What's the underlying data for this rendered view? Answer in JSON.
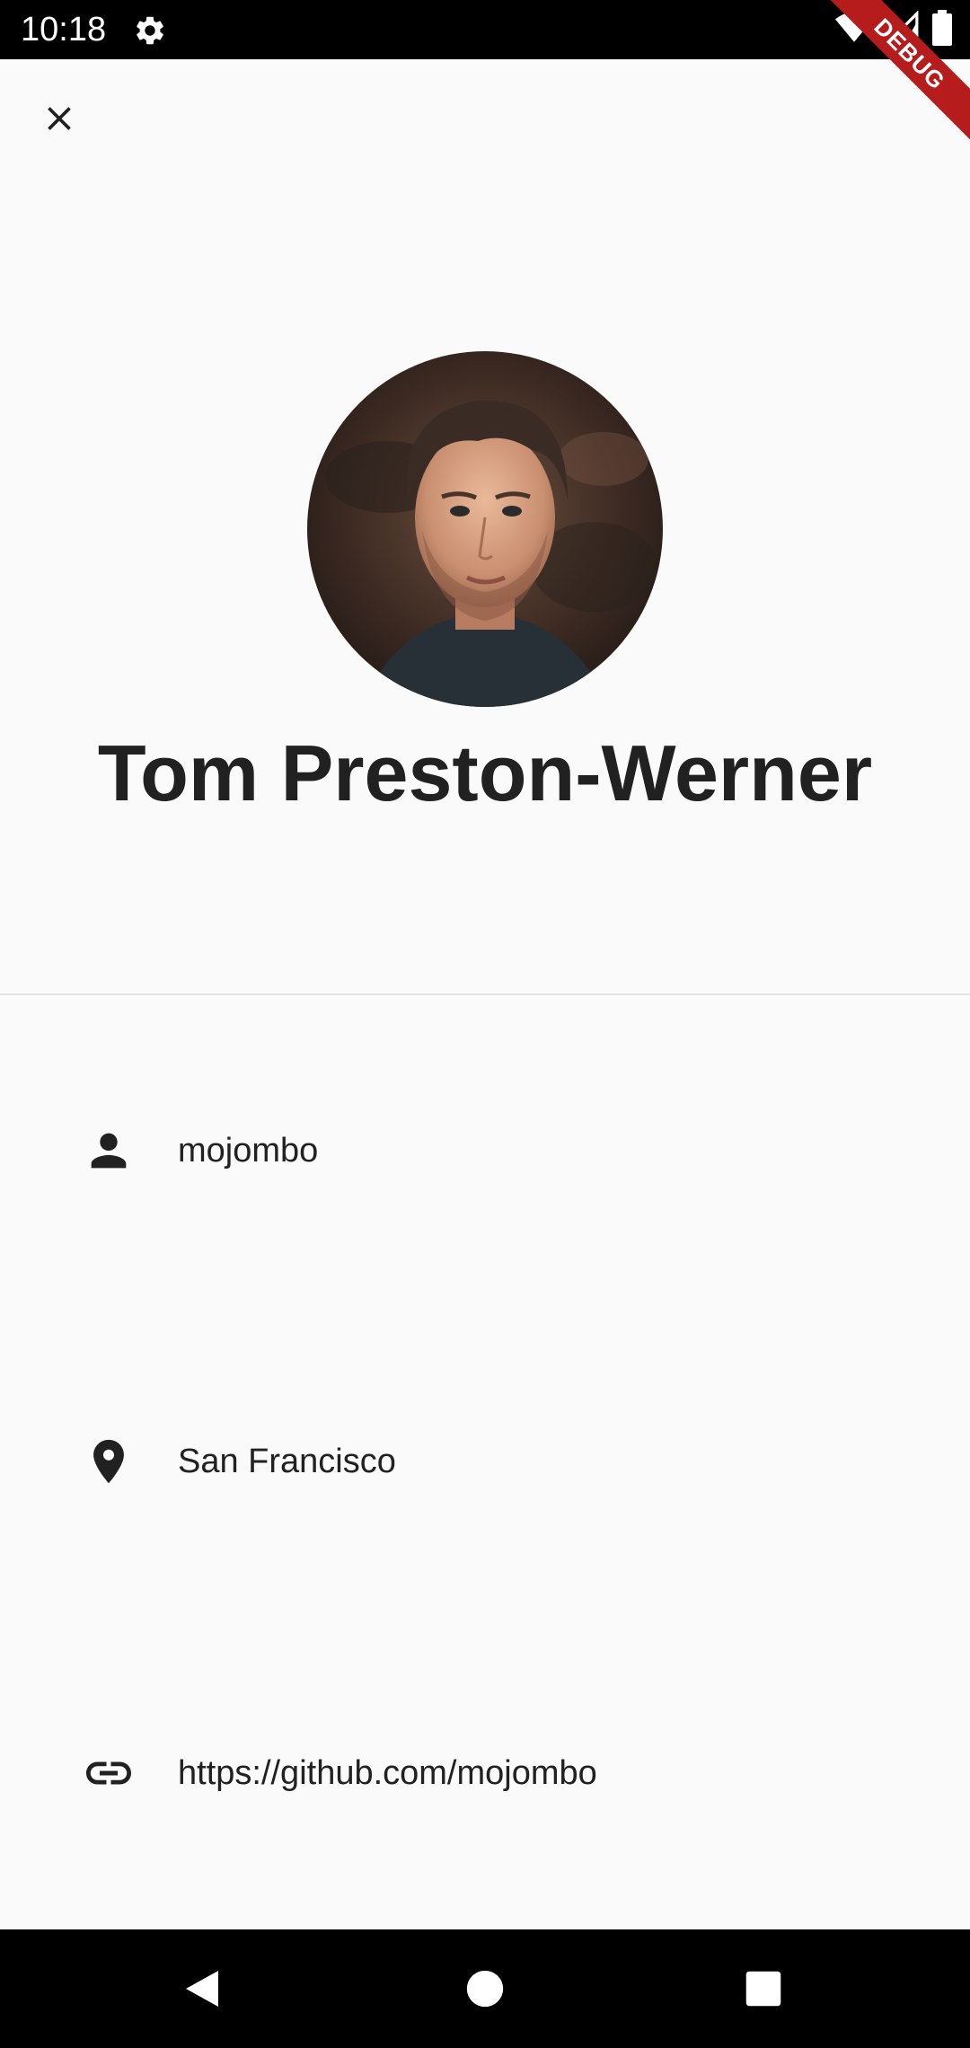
{
  "status_bar": {
    "time": "10:18",
    "icons": [
      "settings-icon",
      "wifi-icon",
      "signal-icon",
      "battery-icon"
    ]
  },
  "debug_banner": {
    "label": "DEBUG"
  },
  "header": {
    "close_icon": "close-icon"
  },
  "profile": {
    "name": "Tom Preston-Werner",
    "avatar": "profile-photo"
  },
  "details": {
    "username": "mojombo",
    "location": "San Francisco",
    "link": "https://github.com/mojombo"
  },
  "navigation": {
    "buttons": [
      "back-icon",
      "home-icon",
      "recents-icon"
    ]
  },
  "colors": {
    "background": "#fafafa",
    "text": "#212121",
    "debug_banner": "#b71c1c",
    "system_bars": "#000000"
  }
}
